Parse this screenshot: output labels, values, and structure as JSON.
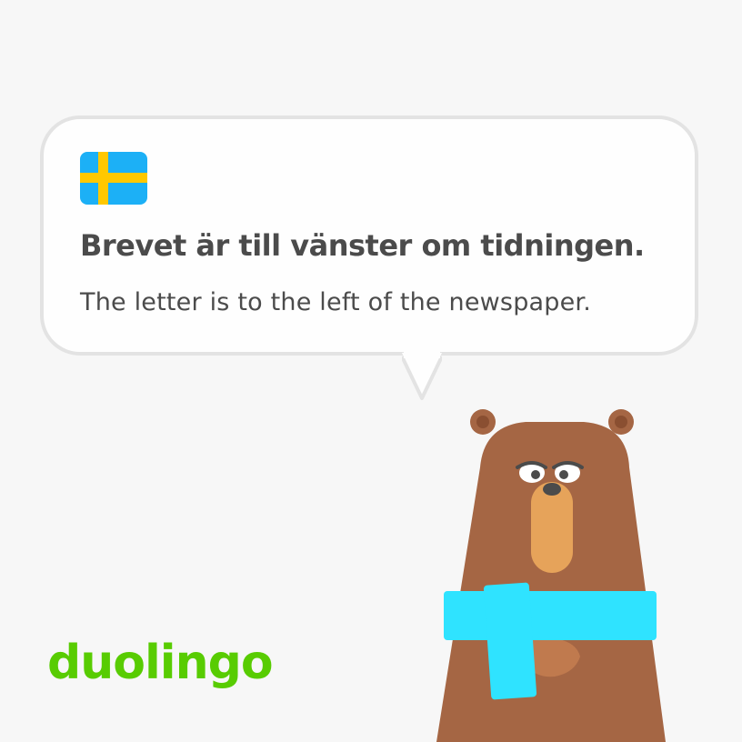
{
  "card": {
    "flag_icon": "sweden-flag-icon",
    "sentence": "Brevet är till vänster om tidningen.",
    "translation": "The letter is to the left of the newspaper."
  },
  "brand": {
    "logo_text": "duolingo"
  },
  "character": {
    "icon": "bear-character-icon"
  },
  "colors": {
    "background": "#f7f7f7",
    "bubble_border": "#e3e3e3",
    "text": "#4b4b4b",
    "logo_green": "#58cc02",
    "flag_blue": "#1cb0f6",
    "flag_yellow": "#ffc800",
    "bear_fur": "#a56644",
    "bear_snout": "#e6a35a",
    "scarf": "#2fe3ff"
  }
}
